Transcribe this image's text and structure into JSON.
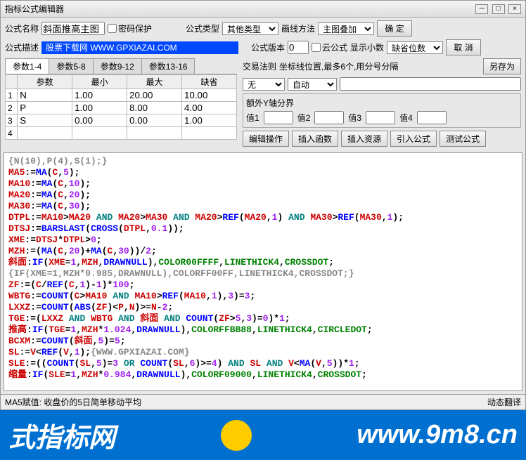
{
  "title": "指标公式编辑器",
  "labels": {
    "name": "公式名称",
    "desc": "公式描述",
    "type": "公式类型",
    "drawMethod": "画线方法",
    "version": "公式版本",
    "decimal": "显示小数",
    "password": "密码保护",
    "cloud": "云公式",
    "ok": "确  定",
    "cancel": "取  消",
    "saveAs": "另存为",
    "tradeRule": "交易法则",
    "coordHint": "坐标线位置,最多6个,用分号分隔",
    "extraAxis": "额外Y轴分界",
    "v1": "值1",
    "v2": "值2",
    "v3": "值3",
    "v4": "值4",
    "editOp": "编辑操作",
    "insertFn": "插入函数",
    "insertRes": "插入资源",
    "importFormula": "引入公式",
    "testFormula": "测试公式",
    "dynTranslate": "动态翻译"
  },
  "form": {
    "name": "斜面推高主图",
    "descText": "股票下载网 WWW.GPXIAZAI.COM",
    "type": "其他类型",
    "drawMethod": "主图叠加",
    "version": "0",
    "decimal": "缺省位数",
    "tradeRule": "无",
    "coordMode": "自动"
  },
  "tabs": {
    "t1": "参数1-4",
    "t2": "参数5-8",
    "t3": "参数9-12",
    "t4": "参数13-16"
  },
  "paramHeaders": [
    "",
    "参数",
    "最小",
    "最大",
    "缺省"
  ],
  "params": [
    {
      "i": "1",
      "name": "N",
      "min": "1.00",
      "max": "20.00",
      "def": "10.00"
    },
    {
      "i": "2",
      "name": "P",
      "min": "1.00",
      "max": "8.00",
      "def": "4.00"
    },
    {
      "i": "3",
      "name": "S",
      "min": "0.00",
      "max": "0.00",
      "def": "1.00"
    },
    {
      "i": "4",
      "name": "",
      "min": "",
      "max": "",
      "def": ""
    }
  ],
  "status": "MA5赋值: 收盘价的5日简单移动平均",
  "banner": {
    "left": "式指标网",
    "right": "www.9m8.cn"
  }
}
